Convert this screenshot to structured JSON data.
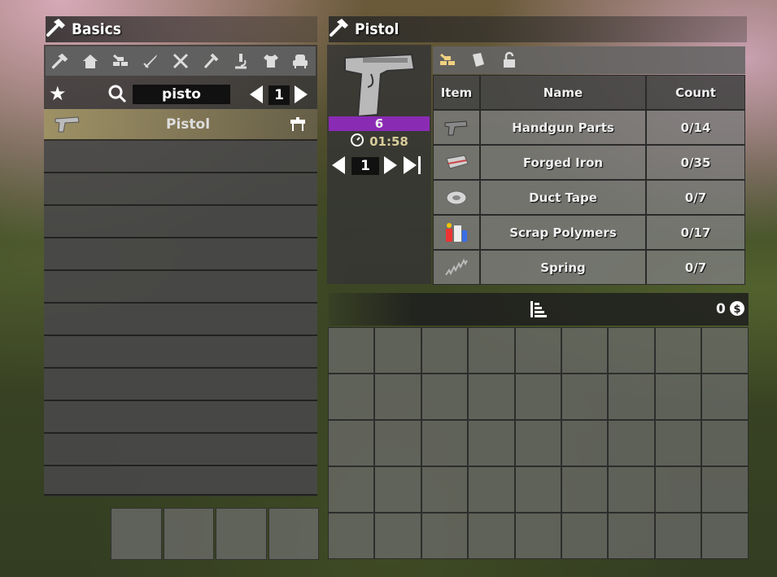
{
  "left": {
    "title": "Basics",
    "categories": [
      "all-icon",
      "house-icon",
      "building-blocks-icon",
      "sword-icon",
      "tools-icon",
      "fork-icon",
      "microscope-icon",
      "shirt-icon",
      "armchair-icon"
    ],
    "search": {
      "value": "pisto"
    },
    "page": "1",
    "recipes": [
      {
        "name": "Pistol"
      }
    ],
    "empty_rows": 11
  },
  "right": {
    "title": "Pistol",
    "quantity": "6",
    "craft_time": "01:58",
    "craft_count": "1",
    "columns": {
      "item": "Item",
      "name": "Name",
      "count": "Count"
    },
    "ingredients": [
      {
        "name": "Handgun Parts",
        "count": "0/14",
        "icon": "handgun-parts-icon"
      },
      {
        "name": "Forged Iron",
        "count": "0/35",
        "icon": "forged-iron-icon"
      },
      {
        "name": "Duct Tape",
        "count": "0/7",
        "icon": "duct-tape-icon"
      },
      {
        "name": "Scrap Polymers",
        "count": "0/17",
        "icon": "scrap-polymers-icon"
      },
      {
        "name": "Spring",
        "count": "0/7",
        "icon": "spring-icon"
      }
    ],
    "money": "0",
    "colors": {
      "accent_purple": "#8a2bb4"
    }
  }
}
